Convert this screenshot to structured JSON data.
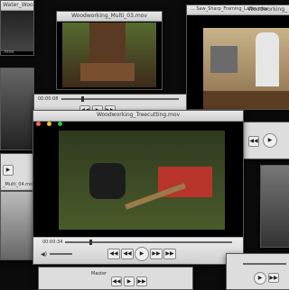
{
  "windows": {
    "top_left": {
      "title": "Water_Wooden_F",
      "sub": ".mov"
    },
    "top_center": {
      "title": "Woodworking_Multi_03.mov"
    },
    "top_right": {
      "title": "Woodworking_",
      "sub": "... Saw_Sharp_Framing_Lathe.mov"
    },
    "mid_left": {
      "title": "_Multi_04.mov"
    },
    "center_upper": {
      "time": "00:00:08"
    },
    "main": {
      "title": "Woodworking_Treecutting.mov",
      "time": "00:00:34"
    },
    "right_small": {
      "title": ".mov"
    },
    "bottom_center": {
      "label": "Master"
    }
  },
  "controls": {
    "rewind": "◀◀",
    "prev": "◀◀",
    "play": "▶",
    "next": "▶▶",
    "forward": "▶▶",
    "stop": "■"
  },
  "colors": {
    "accent": "#ff5f57",
    "yellow": "#febc2e",
    "green": "#28c840"
  }
}
